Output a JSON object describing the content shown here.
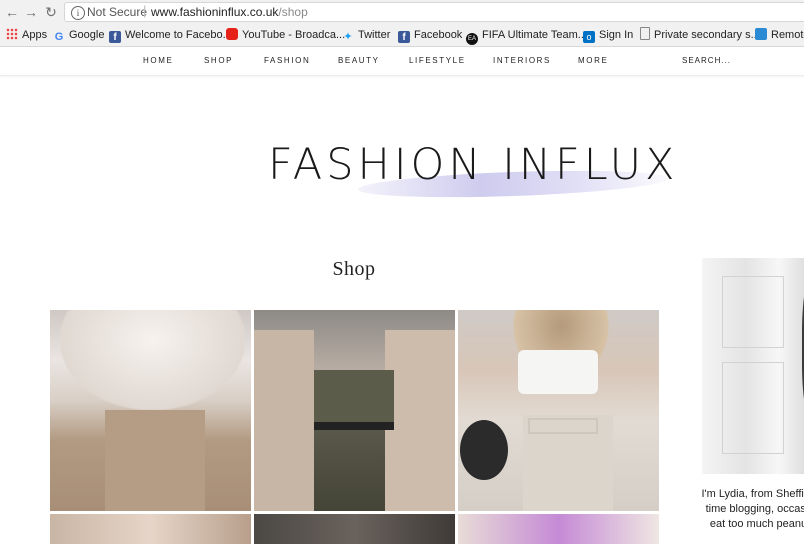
{
  "browser": {
    "address": {
      "security_label": "Not Secure",
      "url_domain": "www.fashioninflux.co.uk",
      "url_path": "/shop"
    },
    "bookmarks": [
      {
        "label": "Apps",
        "icon": "apps-grid-icon"
      },
      {
        "label": "Google",
        "icon": "google-icon"
      },
      {
        "label": "Welcome to Facebo...",
        "icon": "facebook-icon"
      },
      {
        "label": "YouTube - Broadca...",
        "icon": "youtube-icon"
      },
      {
        "label": "Twitter",
        "icon": "twitter-icon"
      },
      {
        "label": "Facebook",
        "icon": "facebook-icon"
      },
      {
        "label": "FIFA Ultimate Team...",
        "icon": "ea-icon"
      },
      {
        "label": "Sign In",
        "icon": "outlook-icon"
      },
      {
        "label": "Private secondary s...",
        "icon": "document-icon"
      },
      {
        "label": "Remote",
        "icon": "remote-icon"
      }
    ]
  },
  "site_nav": {
    "items": [
      "HOME",
      "SHOP",
      "FASHION",
      "BEAUTY",
      "LIFESTYLE",
      "INTERIORS",
      "MORE"
    ],
    "search_placeholder": "SEARCH..."
  },
  "logo": {
    "text": "FASHION INFLUX"
  },
  "shop": {
    "title": "Shop"
  },
  "sidebar": {
    "bio_lines": [
      "I'm Lydia, from Sheffield",
      "time blogging, occasio",
      "eat too much peanut"
    ]
  },
  "colors": {
    "brush": "#c4c0eb",
    "chrome": "#f1f1f1",
    "text": "#222222"
  }
}
